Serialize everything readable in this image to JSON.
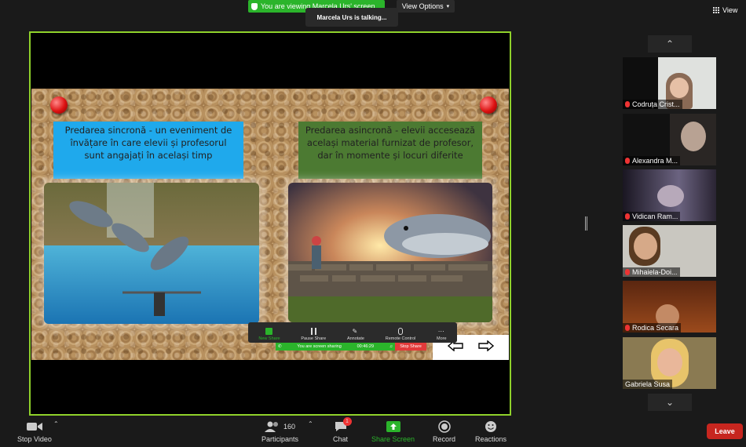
{
  "top": {
    "viewing_banner": "You are viewing Marcela Urs' screen",
    "view_options": "View Options",
    "talking": "Marcela Urs is talking...",
    "gallery_view": "View"
  },
  "slide": {
    "box_left": "Predarea sincronă - un eveniment de învățare în care elevii și profesorul sunt angajați în același timp",
    "box_right": "Predarea asincronă  - elevii accesează același material furnizat de profesor, dar în momente și locuri diferite"
  },
  "share_toolbar": {
    "items": [
      {
        "label": "New Share",
        "icon": "new-share-icon"
      },
      {
        "label": "Pause Share",
        "icon": "pause-icon"
      },
      {
        "label": "Annotate",
        "icon": "pencil-icon"
      },
      {
        "label": "Remote Control",
        "icon": "mouse-icon"
      },
      {
        "label": "More",
        "icon": "more-icon"
      }
    ],
    "status": "You are screen sharing",
    "timer": "00:46:29",
    "stop_share": "Stop Share"
  },
  "participants": [
    {
      "name": "Codruța Crist..."
    },
    {
      "name": "Alexandra M..."
    },
    {
      "name": "Vidican Ram..."
    },
    {
      "name": "Mihaiela-Doi..."
    },
    {
      "name": "Rodica Secara"
    },
    {
      "name": "Gabriela Susa"
    }
  ],
  "bottom": {
    "stop_video": "Stop Video",
    "participants_label": "Participants",
    "participants_count": "160",
    "chat": "Chat",
    "chat_badge": "1",
    "share_screen": "Share Screen",
    "record": "Record",
    "reactions": "Reactions",
    "leave": "Leave"
  },
  "colors": {
    "accent_green": "#2bb42b",
    "share_border": "#8fd12a",
    "leave_red": "#c7261f"
  }
}
